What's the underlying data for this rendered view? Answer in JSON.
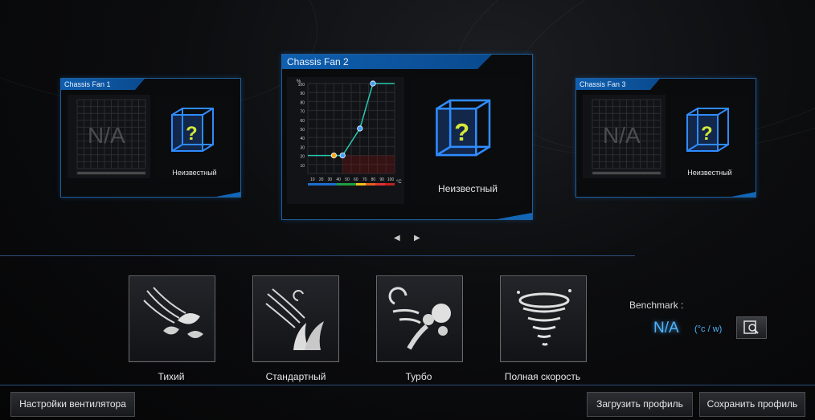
{
  "fans": [
    {
      "title": "Chassis Fan 1",
      "status": "Неизвестный",
      "graph_text": "N/A",
      "graph_icon": "question-cube-icon"
    },
    {
      "title": "Chassis Fan 2",
      "status": "Неизвестный",
      "graph_icon": "question-cube-icon",
      "graph": {
        "y_unit": "%",
        "x_unit": "°C",
        "y_ticks": [
          "100",
          "90",
          "80",
          "70",
          "60",
          "50",
          "40",
          "30",
          "20",
          "10"
        ],
        "x_ticks": [
          "10",
          "20",
          "30",
          "40",
          "50",
          "60",
          "70",
          "80",
          "90",
          "100"
        ],
        "curve_points": [
          {
            "temp": 0,
            "speed": 20
          },
          {
            "temp": 30,
            "speed": 20
          },
          {
            "temp": 40,
            "speed": 20
          },
          {
            "temp": 60,
            "speed": 50
          },
          {
            "temp": 75,
            "speed": 100
          },
          {
            "temp": 100,
            "speed": 100
          }
        ],
        "handles": [
          {
            "temp": 30,
            "speed": 20,
            "color": "#f5a623"
          },
          {
            "temp": 40,
            "speed": 20,
            "color": "#3fa0ff"
          },
          {
            "temp": 60,
            "speed": 50,
            "color": "#3fa0ff"
          },
          {
            "temp": 75,
            "speed": 100,
            "color": "#3fa0ff"
          }
        ],
        "temp_zones": [
          "#1e6fd0",
          "#1e6fd0",
          "#1e6fd0",
          "#1fa040",
          "#1fa040",
          "#f0c020",
          "#e06020",
          "#e03030",
          "#c02020"
        ]
      }
    },
    {
      "title": "Chassis Fan 3",
      "status": "Неизвестный",
      "graph_text": "N/A",
      "graph_icon": "question-cube-icon"
    }
  ],
  "modes": [
    {
      "label": "Тихий",
      "icon": "silent-leaves-icon"
    },
    {
      "label": "Стандартный",
      "icon": "standard-grass-icon"
    },
    {
      "label": "Турбо",
      "icon": "turbo-wind-icon"
    },
    {
      "label": "Полная скорость",
      "icon": "tornado-icon"
    }
  ],
  "benchmark": {
    "label": "Benchmark :",
    "value": "N/A",
    "unit": "(°c / w)",
    "button_icon": "benchmark-search-icon"
  },
  "buttons": {
    "fan_settings": "Настройки вентилятора",
    "load_profile": "Загрузить профиль",
    "save_profile": "Сохранить профиль"
  },
  "colors": {
    "accent": "#1166b8",
    "curve": "#29c7b0",
    "glow": "#4fb4ff"
  }
}
